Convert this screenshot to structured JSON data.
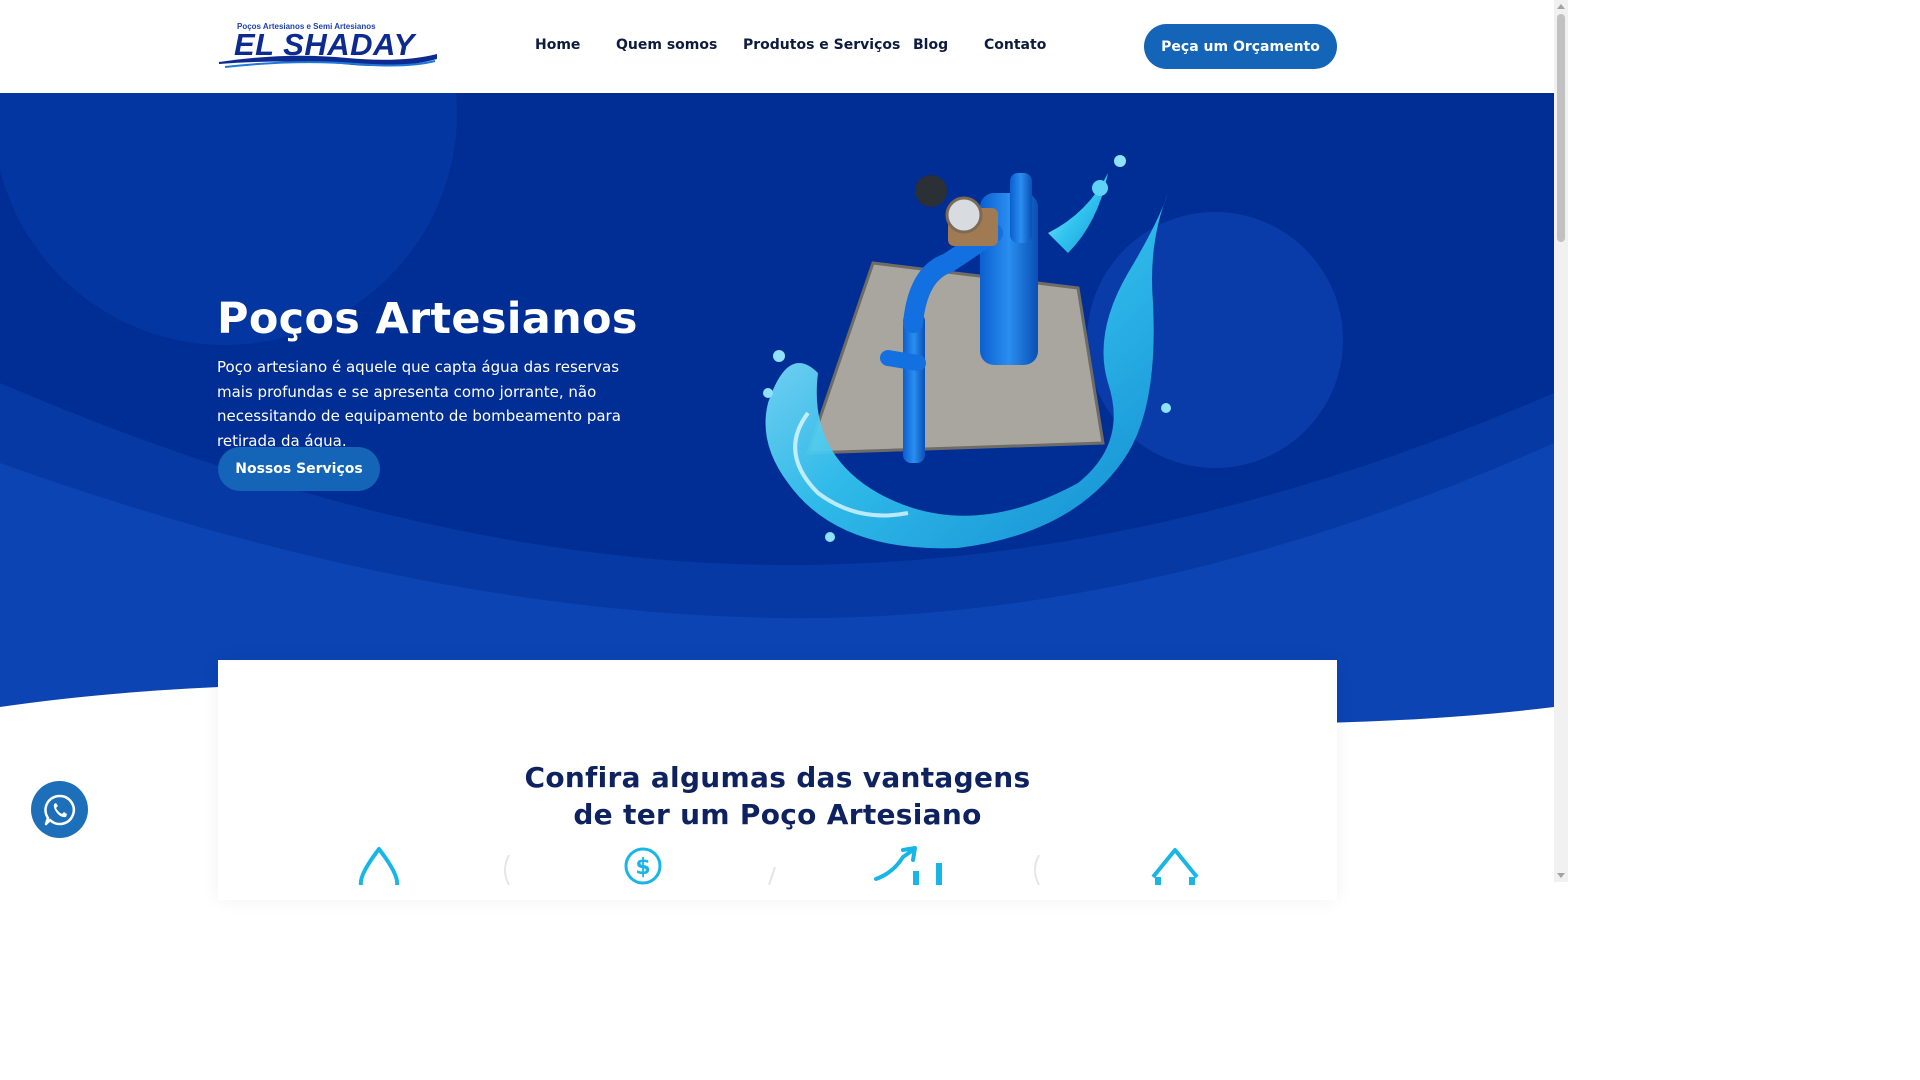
{
  "header": {
    "logo": {
      "tagline": "Poços Artesianos e Semi Artesianos",
      "name": "EL SHADAY"
    },
    "nav": [
      {
        "label": "Home"
      },
      {
        "label": "Quem somos"
      },
      {
        "label": "Produtos e Serviços"
      },
      {
        "label": "Blog"
      },
      {
        "label": "Contato"
      }
    ],
    "cta_label": "Peça um Orçamento"
  },
  "hero": {
    "title": "Poços Artesianos",
    "description": "Poço artesiano é aquele que capta água das reservas mais profundas e se apresenta como jorrante, não necessitando de equipamento de bombeamento para retirada da água.",
    "button_label": "Nossos Serviços"
  },
  "advantages": {
    "title_line1": "Confira algumas das vantagens",
    "title_line2": "de ter um Poço Artesiano",
    "icons": [
      "water-drop-icon",
      "dollar-coin-icon",
      "growth-chart-icon",
      "house-icon"
    ]
  },
  "whatsapp": {
    "icon": "whatsapp-icon"
  },
  "colors": {
    "brand_dark": "#003399",
    "brand_button": "#1464b7",
    "accent_cyan": "#17b6e6",
    "heading": "#0f2260"
  }
}
